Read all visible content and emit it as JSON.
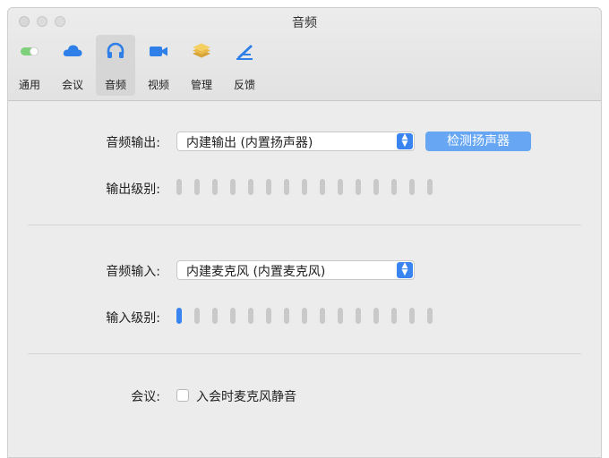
{
  "window": {
    "title": "音频"
  },
  "toolbar": {
    "items": [
      {
        "label": "通用",
        "icon": "toggle-icon",
        "selected": false
      },
      {
        "label": "会议",
        "icon": "cloud-icon",
        "selected": false
      },
      {
        "label": "音频",
        "icon": "headphones-icon",
        "selected": true
      },
      {
        "label": "视频",
        "icon": "video-camera-icon",
        "selected": false
      },
      {
        "label": "管理",
        "icon": "stack-icon",
        "selected": false
      },
      {
        "label": "反馈",
        "icon": "feedback-icon",
        "selected": false
      }
    ]
  },
  "audio_output": {
    "label": "音频输出:",
    "device": "内建输出 (内置扬声器)",
    "test_button": "检测扬声器",
    "level_label": "输出级别:",
    "level_segments": 15,
    "level_active": 0
  },
  "audio_input": {
    "label": "音频输入:",
    "device": "内建麦克风 (内置麦克风)",
    "level_label": "输入级别:",
    "level_segments": 15,
    "level_active": 1
  },
  "meeting": {
    "label": "会议:",
    "mute_on_join_label": "入会时麦克风静音",
    "mute_on_join_checked": false
  },
  "colors": {
    "accent": "#3a84f0",
    "button": "#67a6f2",
    "window_bg": "#ececec"
  }
}
